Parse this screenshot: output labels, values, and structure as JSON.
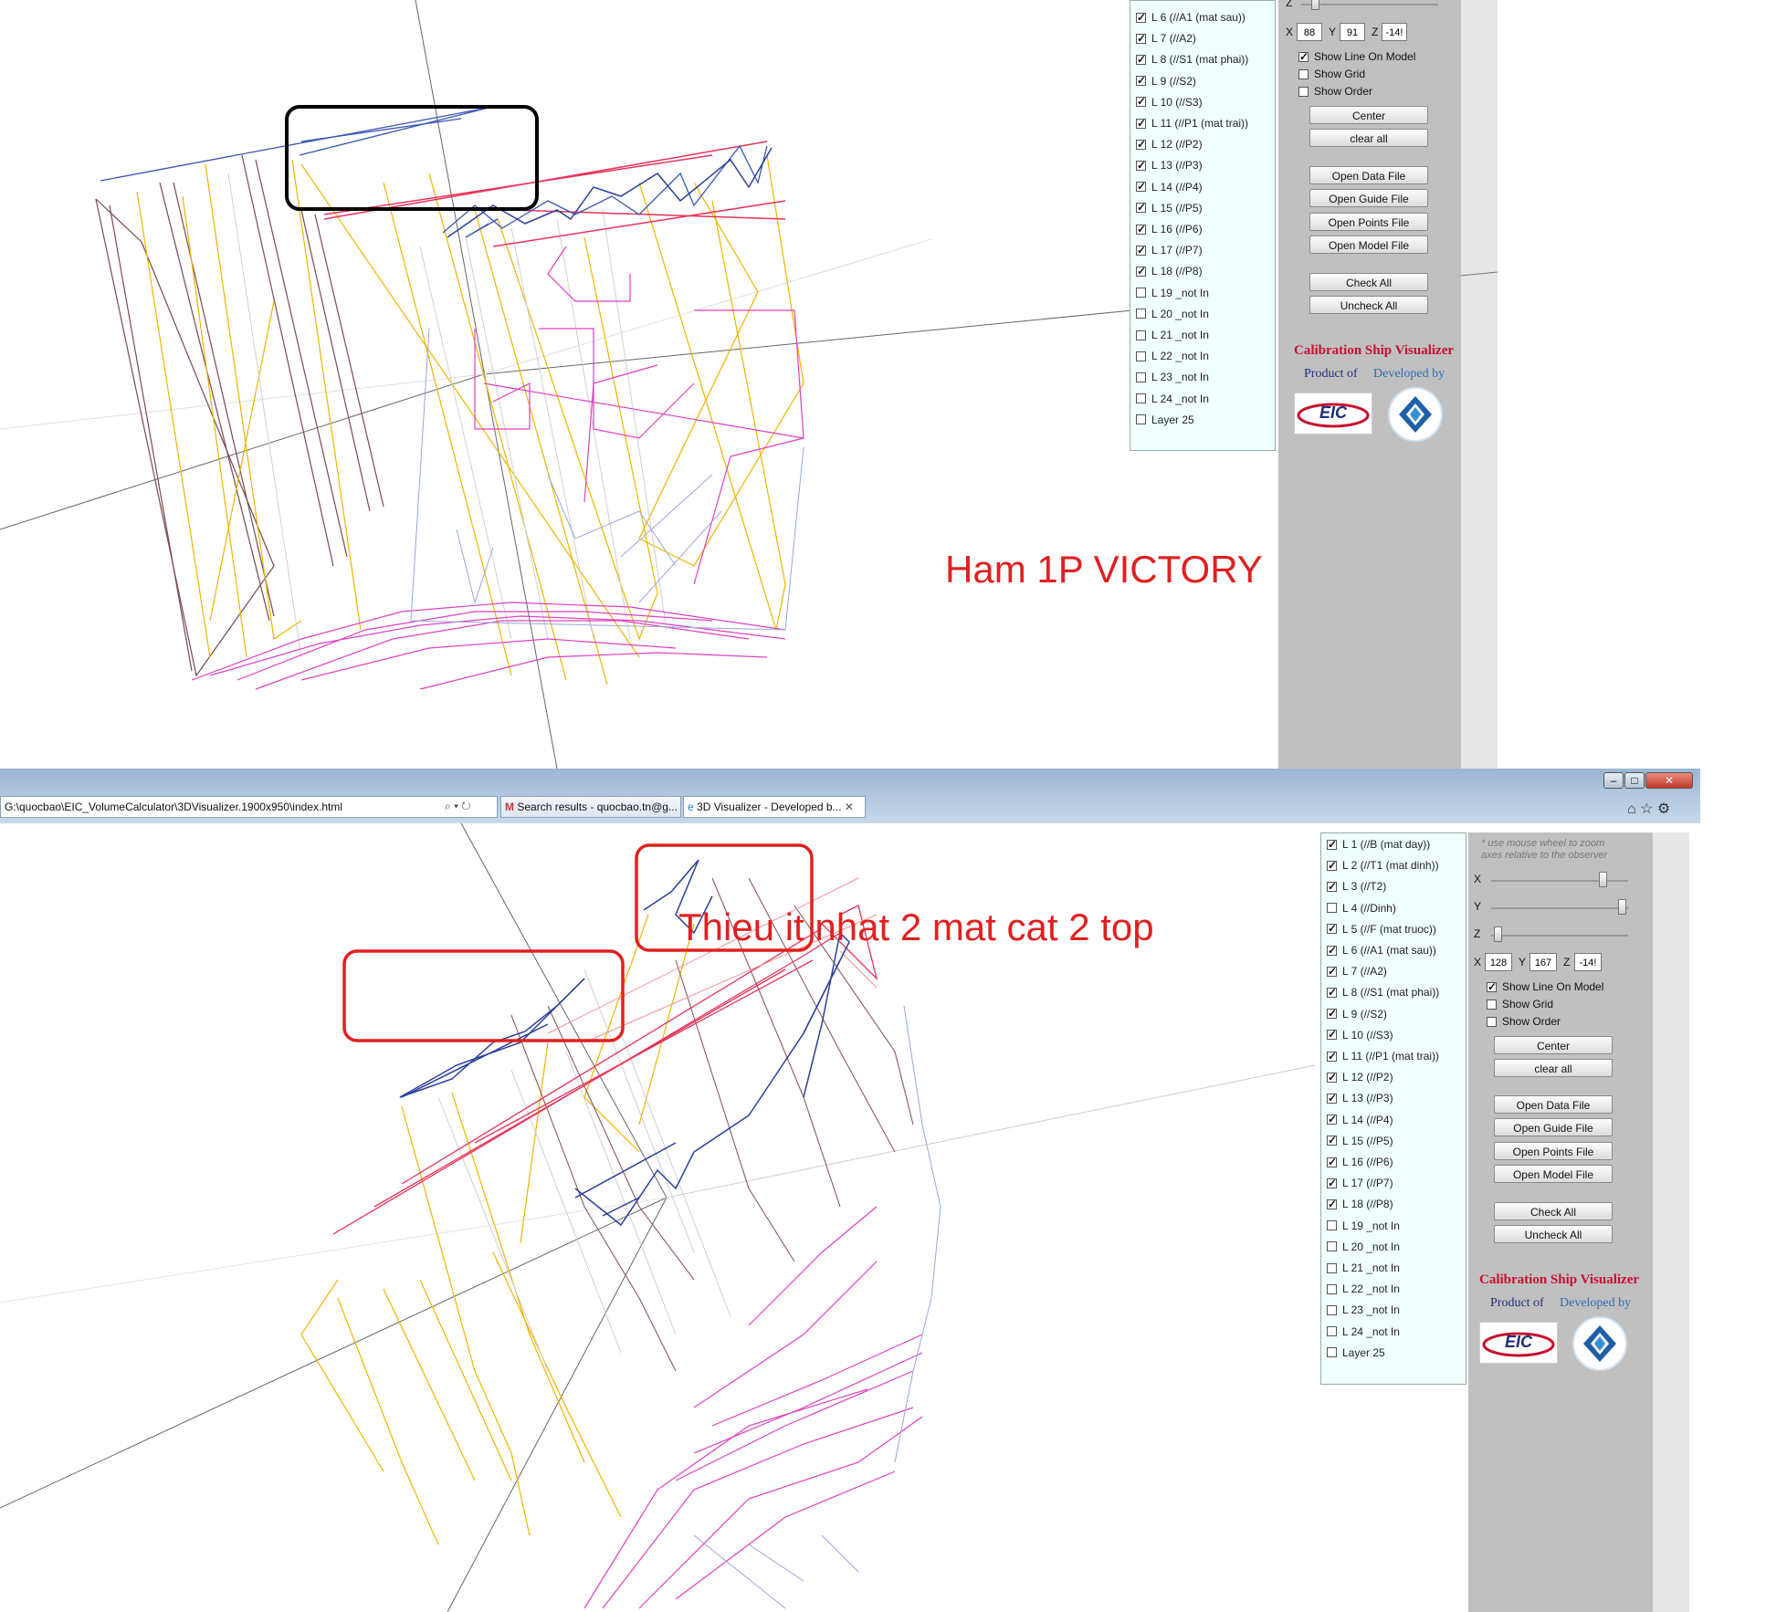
{
  "top": {
    "annotation": "Ham 1P VICTORY",
    "layers": [
      {
        "label": "L 6 (//A1 (mat sau))",
        "checked": true
      },
      {
        "label": "L 7 (//A2)",
        "checked": true
      },
      {
        "label": "L 8 (//S1 (mat phai))",
        "checked": true
      },
      {
        "label": "L 9 (//S2)",
        "checked": true
      },
      {
        "label": "L 10 (//S3)",
        "checked": true
      },
      {
        "label": "L 11 (//P1 (mat trai))",
        "checked": true
      },
      {
        "label": "L 12 (//P2)",
        "checked": true
      },
      {
        "label": "L 13 (//P3)",
        "checked": true
      },
      {
        "label": "L 14 (//P4)",
        "checked": true
      },
      {
        "label": "L 15 (//P5)",
        "checked": true
      },
      {
        "label": "L 16 (//P6)",
        "checked": true
      },
      {
        "label": "L 17 (//P7)",
        "checked": true
      },
      {
        "label": "L 18 (//P8)",
        "checked": true
      },
      {
        "label": "L 19 _not In",
        "checked": false
      },
      {
        "label": "L 20 _not In",
        "checked": false
      },
      {
        "label": "L 21 _not In",
        "checked": false
      },
      {
        "label": "L 22 _not In",
        "checked": false
      },
      {
        "label": "L 23 _not In",
        "checked": false
      },
      {
        "label": "L 24 _not In",
        "checked": false
      },
      {
        "label": "Layer 25",
        "checked": false
      }
    ],
    "controls": {
      "z_slider_label": "Z",
      "x_label": "X",
      "x_value": "88",
      "y_label": "Y",
      "y_value": "91",
      "z_label": "Z",
      "z_value": "-14!",
      "show_line_on_model": "Show Line On Model",
      "show_line_on_model_checked": true,
      "show_grid": "Show Grid",
      "show_order": "Show Order",
      "center": "Center",
      "clear_all": "clear all",
      "open_data_file": "Open Data File",
      "open_guide_file": "Open Guide File",
      "open_points_file": "Open Points File",
      "open_model_file": "Open Model File",
      "check_all": "Check All",
      "uncheck_all": "Uncheck All"
    },
    "brand": {
      "title": "Calibration Ship Visualizer",
      "product_of": "Product of",
      "developed_by": "Developed by",
      "eic": "EIC"
    }
  },
  "browser": {
    "address": "G:\\quocbao\\EIC_VolumeCalculator\\3DVisualizer.1900x950\\index.html",
    "tabs": [
      {
        "label": "Search results - quocbao.tn@g...",
        "active": false
      },
      {
        "label": "3D Visualizer - Developed b...",
        "active": true
      }
    ],
    "tab_close": "✕",
    "minimize": "–",
    "maximize": "□",
    "close": "✕"
  },
  "bottom": {
    "annotation": "Thieu it nhat 2 mat cat 2 top",
    "hint_line1": "* use mouse wheel to zoom",
    "hint_line2": "axes relative to the observer",
    "slider_x_label": "X",
    "slider_y_label": "Y",
    "slider_z_label": "Z",
    "slider_x_value": 0.83,
    "slider_y_value": 0.98,
    "slider_z_value": 0.02,
    "layers": [
      {
        "label": "L 1 (//B (mat day))",
        "checked": true
      },
      {
        "label": "L 2 (//T1 (mat dinh))",
        "checked": true
      },
      {
        "label": "L 3 (//T2)",
        "checked": true
      },
      {
        "label": "L 4 (//Dinh)",
        "checked": false
      },
      {
        "label": "L 5 (//F (mat truoc))",
        "checked": true
      },
      {
        "label": "L 6 (//A1 (mat sau))",
        "checked": true
      },
      {
        "label": "L 7 (//A2)",
        "checked": true
      },
      {
        "label": "L 8 (//S1 (mat phai))",
        "checked": true
      },
      {
        "label": "L 9 (//S2)",
        "checked": true
      },
      {
        "label": "L 10 (//S3)",
        "checked": true
      },
      {
        "label": "L 11 (//P1 (mat trai))",
        "checked": true
      },
      {
        "label": "L 12 (//P2)",
        "checked": true
      },
      {
        "label": "L 13 (//P3)",
        "checked": true
      },
      {
        "label": "L 14 (//P4)",
        "checked": true
      },
      {
        "label": "L 15 (//P5)",
        "checked": true
      },
      {
        "label": "L 16 (//P6)",
        "checked": true
      },
      {
        "label": "L 17 (//P7)",
        "checked": true
      },
      {
        "label": "L 18 (//P8)",
        "checked": true
      },
      {
        "label": "L 19 _not In",
        "checked": false
      },
      {
        "label": "L 20 _not In",
        "checked": false
      },
      {
        "label": "L 21 _not In",
        "checked": false
      },
      {
        "label": "L 22 _not In",
        "checked": false
      },
      {
        "label": "L 23 _not In",
        "checked": false
      },
      {
        "label": "L 24 _not In",
        "checked": false
      },
      {
        "label": "Layer 25",
        "checked": false
      }
    ],
    "controls": {
      "x_label": "X",
      "x_value": "128",
      "y_label": "Y",
      "y_value": "167",
      "z_label": "Z",
      "z_value": "-14!",
      "show_line_on_model": "Show Line On Model",
      "show_line_on_model_checked": true,
      "show_grid": "Show Grid",
      "show_order": "Show Order",
      "center": "Center",
      "clear_all": "clear all",
      "open_data_file": "Open Data File",
      "open_guide_file": "Open Guide File",
      "open_points_file": "Open Points File",
      "open_model_file": "Open Model File",
      "check_all": "Check All",
      "uncheck_all": "Uncheck All"
    },
    "brand": {
      "title": "Calibration Ship Visualizer",
      "product_of": "Product of",
      "developed_by": "Developed by",
      "eic": "EIC"
    }
  },
  "colors": {
    "annotation": "#e02020",
    "brand_title": "#c8102e",
    "product_of": "#1f2f7a",
    "developed_by": "#2f6db5",
    "layer_panel_bg": "#f0ffff",
    "control_panel_bg": "#c0c0c0",
    "line_blue": "#3a55b5",
    "line_red": "#e8335a",
    "line_pink": "#e040c0",
    "line_gold": "#f0b400",
    "line_brown": "#7a4a50",
    "highlight_black": "#000000",
    "highlight_red": "#e02020"
  }
}
